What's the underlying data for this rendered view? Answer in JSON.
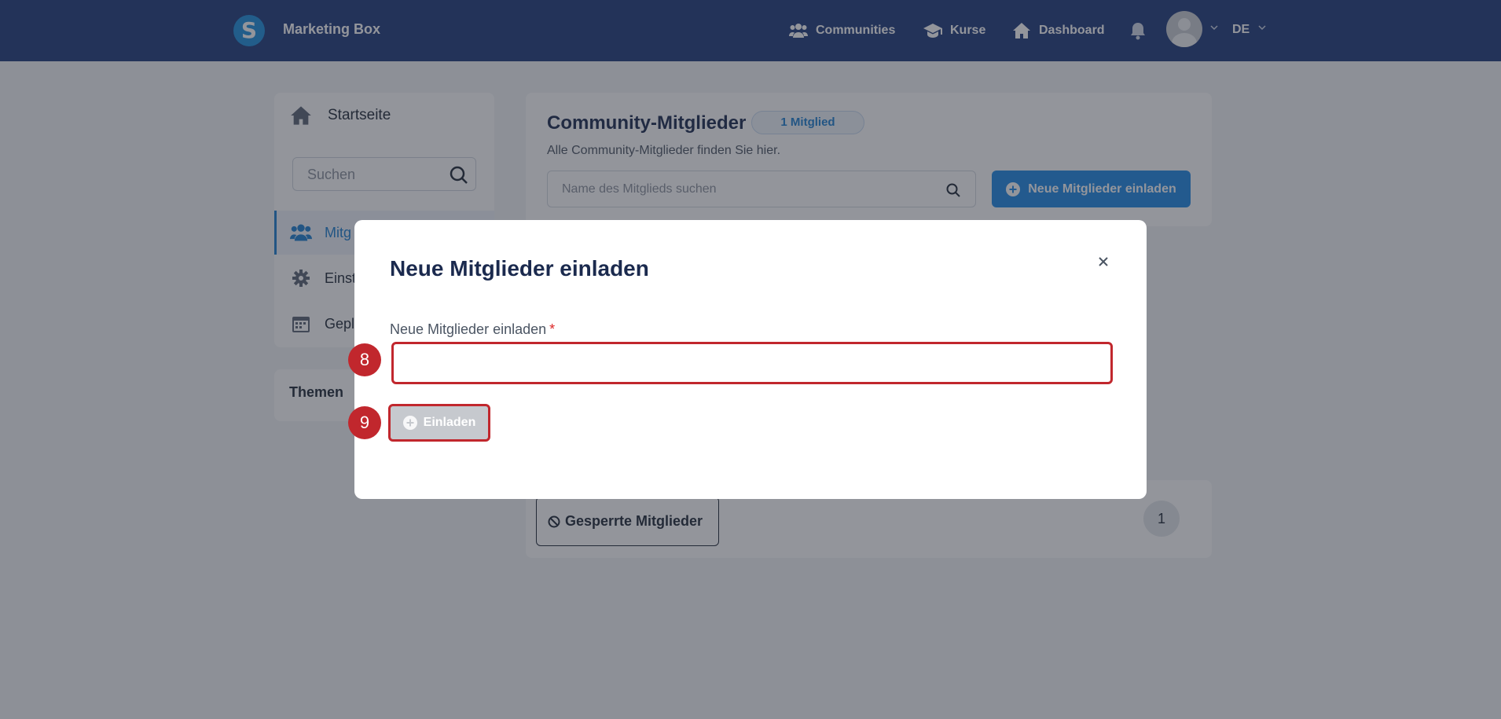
{
  "topbar": {
    "logo_letter": "S",
    "brand": "Marketing Box",
    "nav": [
      {
        "label": "Communities",
        "icon": "users-icon"
      },
      {
        "label": "Kurse",
        "icon": "graduation-cap-icon"
      },
      {
        "label": "Dashboard",
        "icon": "home-icon"
      }
    ],
    "language": "DE"
  },
  "sidebar": {
    "home_label": "Startseite",
    "search_placeholder": "Suchen",
    "items": [
      {
        "label": "Mitg",
        "icon": "users-icon",
        "active": true
      },
      {
        "label": "Einst",
        "icon": "gear-icon",
        "active": false
      },
      {
        "label": "Gepl",
        "icon": "calendar-icon",
        "active": false
      }
    ],
    "themen_label": "Themen"
  },
  "main": {
    "title": "Community-Mitglieder",
    "badge": "1 Mitglied",
    "subtitle": "Alle Community-Mitglieder finden Sie hier.",
    "search_placeholder": "Name des Mitglieds suchen",
    "invite_button": "Neue Mitglieder einladen",
    "blocked_tab": "Gesperrte Mitglieder",
    "blocked_count": "1"
  },
  "modal": {
    "title": "Neue Mitglieder einladen",
    "close": "×",
    "field_label": "Neue Mitglieder einladen",
    "required_mark": "*",
    "field_value": "",
    "submit_label": "Einladen"
  },
  "annotations": {
    "step_input": "8",
    "step_button": "9"
  },
  "colors": {
    "topbar": "#1e3a7b",
    "accent": "#1e88e5",
    "highlight": "#c1272d"
  }
}
